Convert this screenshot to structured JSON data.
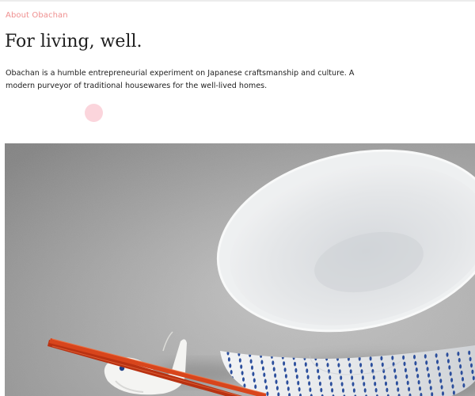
{
  "about": {
    "eyebrow": "About Obachan",
    "headline": "For living, well.",
    "intro": "Obachan is a humble entrepreneurial experiment on Japanese craftsmanship and culture. A modern purveyor of traditional housewares for the well-lived homes."
  },
  "hero_image": {
    "subject": "white-ceramic-rice-bowl-blue-dot-stripes-red-chopsticks-on-bird-rest",
    "colors": {
      "surface": "#b4b4b4",
      "bowl": "#e8e9ea",
      "pattern": "#2b4e9c",
      "chopsticks": "#d8451c"
    }
  },
  "colors": {
    "accent": "#ef8f8f",
    "dot": "#fbd5dc",
    "text": "#1e1e1e"
  }
}
